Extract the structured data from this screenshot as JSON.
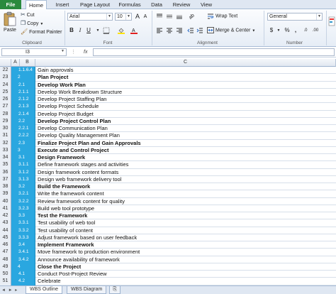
{
  "ribbon": {
    "tabs": [
      {
        "label": "File"
      },
      {
        "label": "Home"
      },
      {
        "label": "Insert"
      },
      {
        "label": "Page Layout"
      },
      {
        "label": "Formulas"
      },
      {
        "label": "Data"
      },
      {
        "label": "Review"
      },
      {
        "label": "View"
      }
    ],
    "clipboard": {
      "paste": "Paste",
      "cut": "Cut",
      "copy": "Copy",
      "format_painter": "Format Painter",
      "group": "Clipboard"
    },
    "font": {
      "name": "Arial",
      "size": "10",
      "group": "Font",
      "bold": "B",
      "italic": "I",
      "underline": "U",
      "grow": "A",
      "shrink": "A"
    },
    "alignment": {
      "wrap_text": "Wrap Text",
      "merge_center": "Merge & Center",
      "group": "Alignment"
    },
    "number": {
      "format": "General",
      "currency": "$",
      "percent": "%",
      "comma": ",",
      "group": "Number"
    }
  },
  "formula_bar": {
    "name_box": "I3",
    "fx": "fx",
    "content": ""
  },
  "columns": {
    "a": "A",
    "b": "B",
    "c": "C"
  },
  "rows": [
    {
      "num": "22",
      "code": "1.1.6.4",
      "text": "Gain approvals",
      "bold": false
    },
    {
      "num": "23",
      "code": "2",
      "text": "Plan Project",
      "bold": true
    },
    {
      "num": "24",
      "code": "2.1",
      "text": "Develop Work Plan",
      "bold": true
    },
    {
      "num": "25",
      "code": "2.1.1",
      "text": "Develop Work Breakdown Structure",
      "bold": false
    },
    {
      "num": "26",
      "code": "2.1.2",
      "text": "Develop Project Staffing Plan",
      "bold": false
    },
    {
      "num": "27",
      "code": "2.1.3",
      "text": "Develop Project Schedule",
      "bold": false
    },
    {
      "num": "28",
      "code": "2.1.4",
      "text": "Develop Project Budget",
      "bold": false
    },
    {
      "num": "29",
      "code": "2.2",
      "text": "Develop Project Control Plan",
      "bold": true
    },
    {
      "num": "30",
      "code": "2.2.1",
      "text": "Develop Communication Plan",
      "bold": false
    },
    {
      "num": "31",
      "code": "2.2.2",
      "text": "Develop Quality Management Plan",
      "bold": false
    },
    {
      "num": "32",
      "code": "2.3",
      "text": "Finalize Project Plan and Gain Approvals",
      "bold": true
    },
    {
      "num": "33",
      "code": "3",
      "text": "Execute and Control Project",
      "bold": true
    },
    {
      "num": "34",
      "code": "3.1",
      "text": "Design Framework",
      "bold": true
    },
    {
      "num": "35",
      "code": "3.1.1",
      "text": "Define framework stages and activities",
      "bold": false
    },
    {
      "num": "36",
      "code": "3.1.2",
      "text": "Design framework content formats",
      "bold": false
    },
    {
      "num": "37",
      "code": "3.1.3",
      "text": "Design web framework delivery tool",
      "bold": false
    },
    {
      "num": "38",
      "code": "3.2",
      "text": "Build the Framework",
      "bold": true
    },
    {
      "num": "39",
      "code": "3.2.1",
      "text": "Write the framework content",
      "bold": false
    },
    {
      "num": "40",
      "code": "3.2.2",
      "text": "Review framework content for quality",
      "bold": false
    },
    {
      "num": "41",
      "code": "3.2.3",
      "text": "Build web tool prototype",
      "bold": false
    },
    {
      "num": "42",
      "code": "3.3",
      "text": "Test the Framework",
      "bold": true
    },
    {
      "num": "43",
      "code": "3.3.1",
      "text": "Test usability of web tool",
      "bold": false
    },
    {
      "num": "44",
      "code": "3.3.2",
      "text": "Test usability of content",
      "bold": false
    },
    {
      "num": "45",
      "code": "3.3.3",
      "text": "Adjust framework based on user feedback",
      "bold": false
    },
    {
      "num": "46",
      "code": "3.4",
      "text": "Implement Framework",
      "bold": true
    },
    {
      "num": "47",
      "code": "3.4.1",
      "text": "Move framework to production environment",
      "bold": false
    },
    {
      "num": "48",
      "code": "3.4.2",
      "text": "Announce availability of framework",
      "bold": false
    },
    {
      "num": "49",
      "code": "4",
      "text": "Close the Project",
      "bold": true
    },
    {
      "num": "50",
      "code": "4.1",
      "text": "Conduct Post-Project Review",
      "bold": false
    },
    {
      "num": "51",
      "code": "4.2",
      "text": "Celebrate",
      "bold": false
    }
  ],
  "sheet_tabs": [
    {
      "label": "WBS Outline",
      "active": true
    },
    {
      "label": "WBS Diagram",
      "active": false
    }
  ],
  "colors": {
    "file_tab": "#2a8a3e",
    "wbs_code_fill": "#2aa7e0",
    "ribbon_bg": "#dfe7f2"
  },
  "icons": [
    "scissors-icon",
    "copy-icon",
    "format-painter-icon",
    "paste-icon",
    "bold-icon",
    "italic-icon",
    "underline-icon",
    "borders-icon",
    "fill-color-icon",
    "font-color-icon",
    "align-left-icon",
    "align-center-icon",
    "align-right-icon",
    "wrap-text-icon",
    "merge-icon",
    "insert-sheet-icon"
  ]
}
